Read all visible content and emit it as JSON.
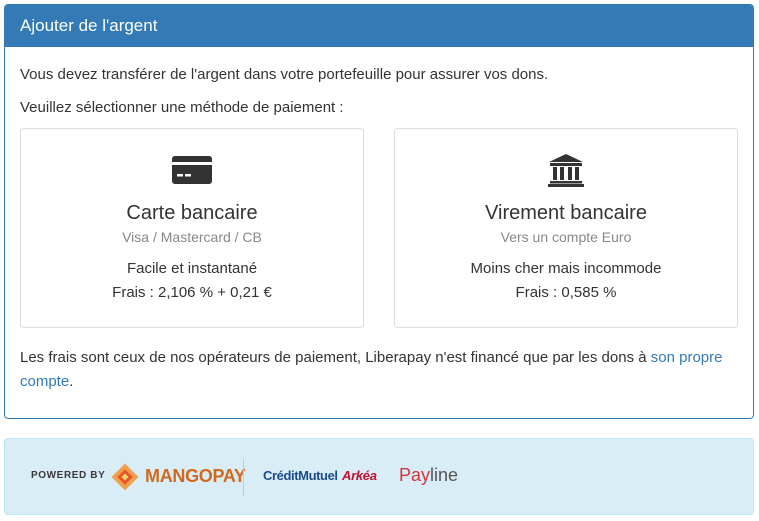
{
  "panel": {
    "title": "Ajouter de l'argent",
    "intro_1": "Vous devez transférer de l'argent dans votre portefeuille pour assurer vos dons.",
    "intro_2": "Veuillez sélectionner une méthode de paiement :"
  },
  "methods": [
    {
      "icon": "credit-card-icon",
      "title": "Carte bancaire",
      "subtitle": "Visa / Mastercard / CB",
      "description": "Facile et instantané",
      "fees": "Frais : 2,106 % + 0,21 €"
    },
    {
      "icon": "bank-icon",
      "title": "Virement bancaire",
      "subtitle": "Vers un compte Euro",
      "description": "Moins cher mais incommode",
      "fees": "Frais : 0,585 %"
    }
  ],
  "note": {
    "text": "Les frais sont ceux de nos opérateurs de paiement, Liberapay n'est financé que par les dons à ",
    "link": "son propre compte",
    "end": "."
  },
  "providers": {
    "powered_by": "POWERED BY",
    "mangopay": "MANGOPAY",
    "cm_part1": "CréditMutuel",
    "cm_part2": "Arkéa",
    "payline_pay": "Pay",
    "payline_line": "line"
  },
  "colors": {
    "primary": "#337ab7",
    "providers_bg": "#d9edf7",
    "mangopay_orange": "#d2691e",
    "cm_blue": "#1c4e8c",
    "arkea_red": "#c8102e",
    "payline_red": "#d6343b"
  }
}
